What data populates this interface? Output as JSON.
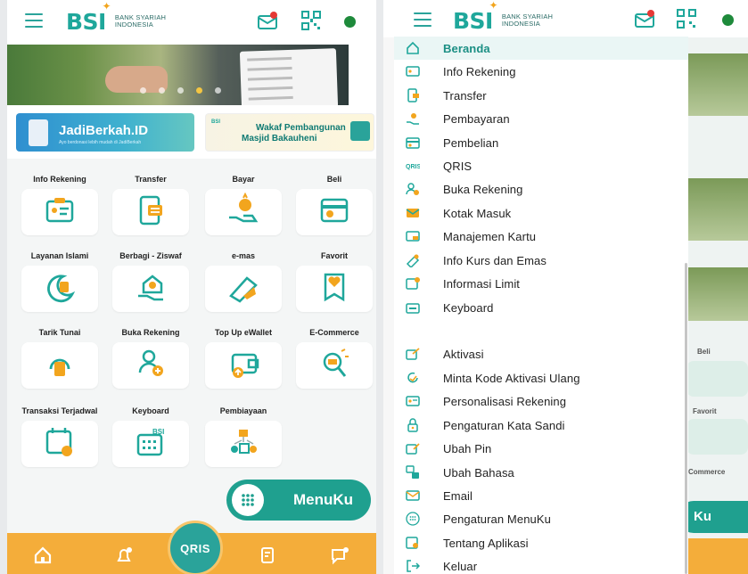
{
  "left": {
    "logo": {
      "brand": "BSI",
      "subtitle_line1": "BANK SYARIAH",
      "subtitle_line2": "INDONESIA"
    },
    "promos": {
      "jadiberkah": {
        "title": "JadiBerkah.ID",
        "subtitle": "Ayo berdonasi lebih mudah di JadiBerkah"
      },
      "wakaf": {
        "line1": "Wakaf Pembangunan",
        "line2": "Masjid Bakauheni",
        "tag": "BSI"
      }
    },
    "menu_tiles": [
      {
        "label": "Info Rekening",
        "icon": "info-rekening-icon"
      },
      {
        "label": "Transfer",
        "icon": "transfer-icon"
      },
      {
        "label": "Bayar",
        "icon": "bayar-icon"
      },
      {
        "label": "Beli",
        "icon": "beli-icon"
      },
      {
        "label": "Layanan Islami",
        "icon": "layanan-islami-icon"
      },
      {
        "label": "Berbagi - Ziswaf",
        "icon": "berbagi-ziswaf-icon"
      },
      {
        "label": "e-mas",
        "icon": "e-mas-icon"
      },
      {
        "label": "Favorit",
        "icon": "favorit-icon"
      },
      {
        "label": "Tarik Tunai",
        "icon": "tarik-tunai-icon"
      },
      {
        "label": "Buka Rekening",
        "icon": "buka-rekening-icon"
      },
      {
        "label": "Top Up eWallet",
        "icon": "top-up-ewallet-icon"
      },
      {
        "label": "E-Commerce",
        "icon": "e-commerce-icon"
      },
      {
        "label": "Transaksi Terjadwal",
        "icon": "transaksi-terjadwal-icon"
      },
      {
        "label": "Keyboard",
        "icon": "keyboard-icon"
      },
      {
        "label": "Pembiayaan",
        "icon": "pembiayaan-icon"
      }
    ],
    "menuku": {
      "label": "MenuKu"
    },
    "qris": {
      "label": "QRIS"
    }
  },
  "right": {
    "logo": {
      "brand": "BSI",
      "subtitle_line1": "BANK SYARIAH",
      "subtitle_line2": "INDONESIA"
    },
    "background_labels": {
      "beli": "Beli",
      "favorit": "Favorit",
      "ecommerce": "Commerce",
      "menuku": "Ku"
    },
    "drawer_items": [
      {
        "label": "Beranda",
        "icon": "home-icon"
      },
      {
        "label": "Info Rekening",
        "icon": "info-rekening-icon"
      },
      {
        "label": "Transfer",
        "icon": "transfer-icon"
      },
      {
        "label": "Pembayaran",
        "icon": "pembayaran-icon"
      },
      {
        "label": "Pembelian",
        "icon": "pembelian-icon"
      },
      {
        "label": "QRIS",
        "icon": "qris-icon"
      },
      {
        "label": "Buka Rekening",
        "icon": "buka-rekening-icon"
      },
      {
        "label": "Kotak Masuk",
        "icon": "kotak-masuk-icon"
      },
      {
        "label": "Manajemen Kartu",
        "icon": "manajemen-kartu-icon"
      },
      {
        "label": "Info Kurs dan Emas",
        "icon": "info-kurs-icon"
      },
      {
        "label": "Informasi Limit",
        "icon": "informasi-limit-icon"
      },
      {
        "label": "Keyboard",
        "icon": "keyboard-icon"
      },
      {
        "label": "Aktivasi",
        "icon": "aktivasi-icon"
      },
      {
        "label": "Minta Kode Aktivasi Ulang",
        "icon": "refresh-icon"
      },
      {
        "label": "Personalisasi Rekening",
        "icon": "personalisasi-icon"
      },
      {
        "label": "Pengaturan Kata Sandi",
        "icon": "lock-icon"
      },
      {
        "label": "Ubah Pin",
        "icon": "pin-icon"
      },
      {
        "label": "Ubah Bahasa",
        "icon": "language-icon"
      },
      {
        "label": "Email",
        "icon": "email-icon"
      },
      {
        "label": "Pengaturan MenuKu",
        "icon": "menuku-icon"
      },
      {
        "label": "Tentang Aplikasi",
        "icon": "info-icon"
      },
      {
        "label": "Keluar",
        "icon": "logout-icon"
      }
    ],
    "active_item": "Beranda"
  },
  "colors": {
    "teal": "#1fa79b",
    "orange": "#f4ad3a",
    "green_dot": "#1e8a3b"
  }
}
